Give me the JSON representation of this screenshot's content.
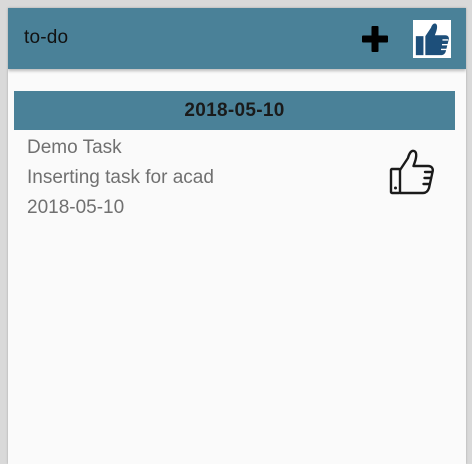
{
  "appbar": {
    "title": "to-do",
    "add_icon": "plus-icon",
    "like_icon": "thumbs-up-filled-icon",
    "color": "#4a8198"
  },
  "sections": [
    {
      "date": "2018-05-10",
      "tasks": [
        {
          "title": "Demo Task",
          "description": "Inserting task for acad",
          "date": "2018-05-10",
          "icon": "thumbs-up-outline-icon"
        }
      ]
    }
  ],
  "colors": {
    "accent": "#4a8198",
    "text_secondary": "#707070",
    "thumb_blue": "#1d4f7a"
  }
}
